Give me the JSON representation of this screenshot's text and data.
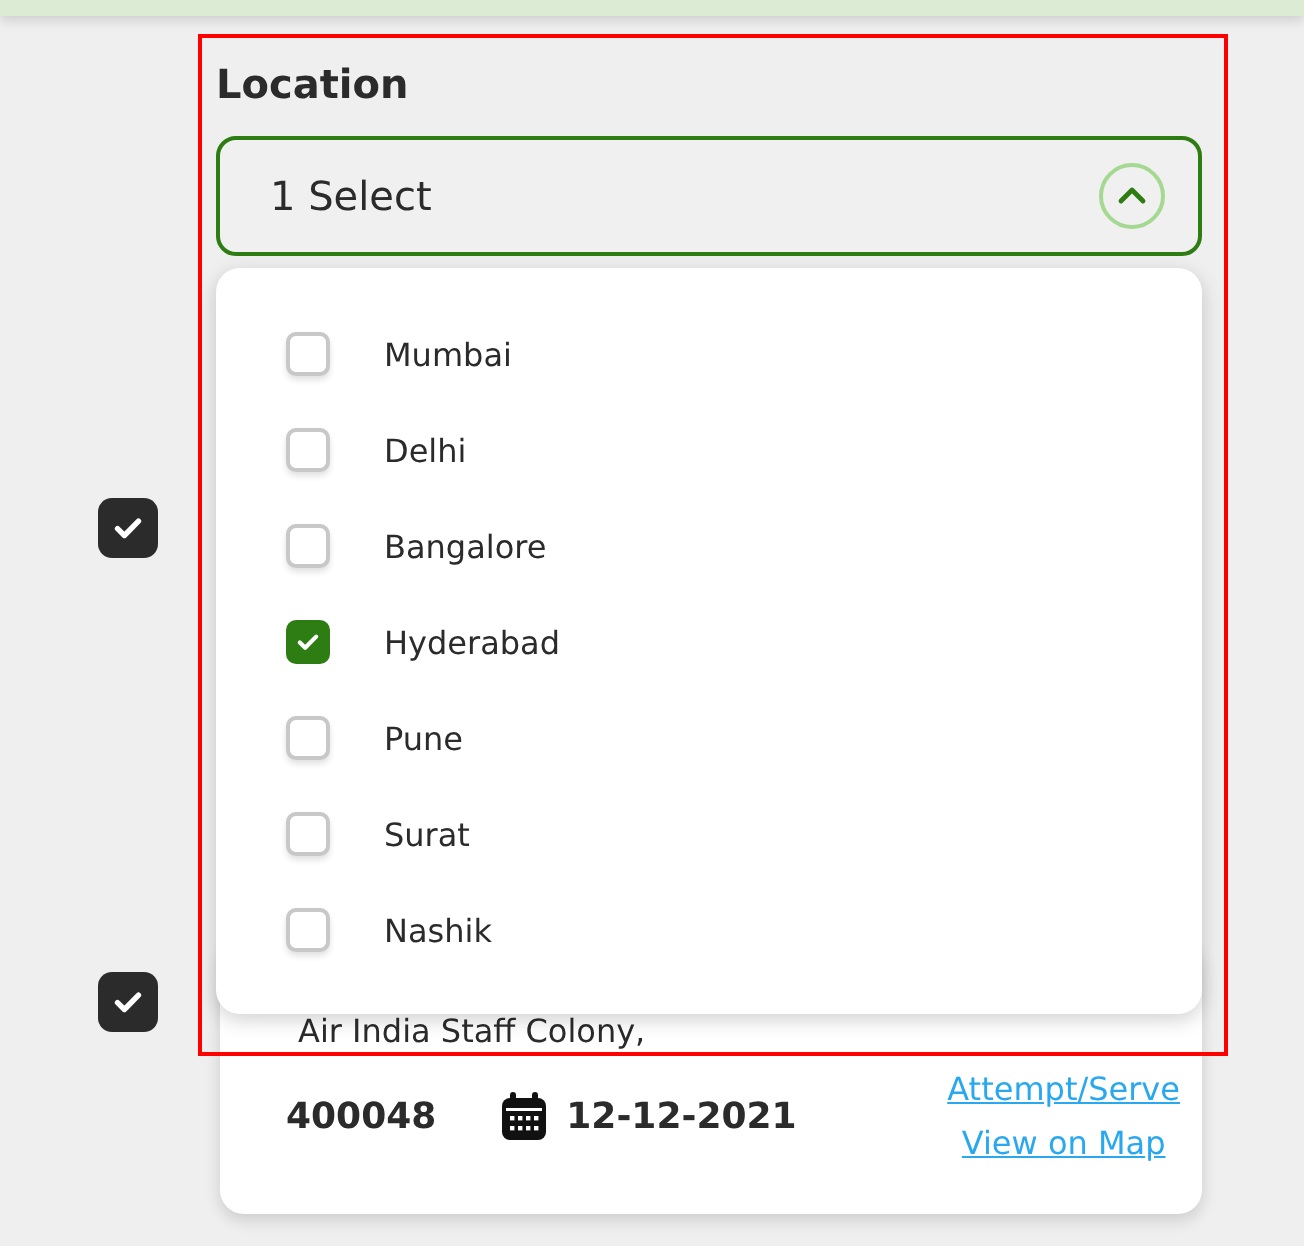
{
  "rows": [
    {
      "checked": true
    },
    {
      "checked": true,
      "card": {
        "address": "Air India Staff Colony,",
        "pincode": "400048",
        "date": "12-12-2021",
        "links": [
          "Attempt/Serve",
          "View on Map"
        ]
      }
    }
  ],
  "location": {
    "label": "Location",
    "value": "1 Select",
    "expanded": true,
    "options": [
      {
        "label": "Mumbai",
        "selected": false
      },
      {
        "label": "Delhi",
        "selected": false
      },
      {
        "label": "Bangalore",
        "selected": false
      },
      {
        "label": "Hyderabad",
        "selected": true
      },
      {
        "label": "Pune",
        "selected": false
      },
      {
        "label": "Surat",
        "selected": false
      },
      {
        "label": "Nashik",
        "selected": false
      }
    ]
  }
}
